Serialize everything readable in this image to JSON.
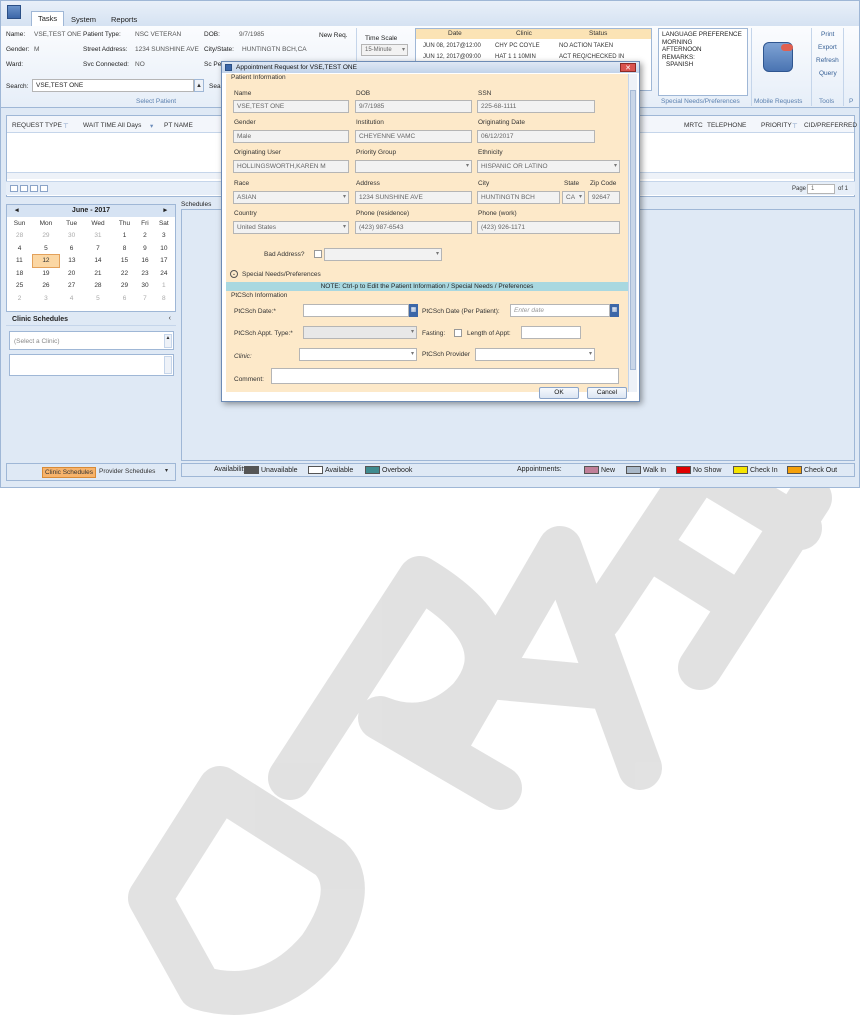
{
  "ribbon": {
    "tabs": [
      "Tasks",
      "System",
      "Reports"
    ],
    "patient": {
      "name_label": "Name:",
      "name": "VSE,TEST ONE",
      "ptype_label": "Patient Type:",
      "ptype": "NSC VETERAN",
      "dob_label": "DOB:",
      "dob": "9/7/1985",
      "gender_label": "Gender:",
      "gender": "M",
      "street_label": "Street Address:",
      "street": "1234 SUNSHINE AVE",
      "citystate_label": "City/State:",
      "citystate": "HUNTINGTN BCH,CA",
      "ward_label": "Ward:",
      "svc_label": "Svc Connected:",
      "svc": "NO",
      "sc_label": "Sc Pe",
      "search_label": "Search:",
      "search_value": "VSE,TEST ONE",
      "search_btn": "Sea",
      "group_caption": "Select Patient"
    },
    "new_req": "New Req.",
    "time_scale": {
      "label": "Time Scale",
      "value": "15-Minute"
    },
    "history": {
      "headers": [
        "Date",
        "Clinic",
        "Status"
      ],
      "rows": [
        [
          "JUN 08, 2017@12:00",
          "CHY PC COYLE",
          "NO ACTION TAKEN"
        ],
        [
          "JUN 12, 2017@09:00",
          "HAT 1 1 10MIN",
          "ACT REQ/CHECKED IN"
        ]
      ]
    },
    "special_needs": {
      "lines": [
        "LANGUAGE PREFERENCE",
        "MORNING",
        "AFTERNOON",
        "REMARKS:",
        "  SPANISH"
      ],
      "caption": "Special Needs/Preferences"
    },
    "mobile_caption": "Mobile Requests",
    "tools": {
      "items": [
        "Print",
        "Export",
        "Refresh",
        "Query"
      ],
      "caption": "Tools"
    },
    "extra_caption": "P"
  },
  "grid": {
    "headers": [
      "REQUEST TYPE",
      "WAIT TIME All Days",
      "PT NAME",
      "MRTC",
      "TELEPHONE",
      "PRIORITY",
      "CID/PREFERRED"
    ],
    "page_label": "Page",
    "page_value": "1",
    "of_label": "of 1"
  },
  "calendar": {
    "title": "June - 2017",
    "days": [
      "Sun",
      "Mon",
      "Tue",
      "Wed",
      "Thu",
      "Fri",
      "Sat"
    ],
    "weeks": [
      [
        "28",
        "29",
        "30",
        "31",
        "1",
        "2",
        "3"
      ],
      [
        "4",
        "5",
        "6",
        "7",
        "8",
        "9",
        "10"
      ],
      [
        "11",
        "12",
        "13",
        "14",
        "15",
        "16",
        "17"
      ],
      [
        "18",
        "19",
        "20",
        "21",
        "22",
        "23",
        "24"
      ],
      [
        "25",
        "26",
        "27",
        "28",
        "29",
        "30",
        "1"
      ],
      [
        "2",
        "3",
        "4",
        "5",
        "6",
        "7",
        "8"
      ]
    ],
    "today": "12"
  },
  "clinic_schedules": {
    "header": "Clinic Schedules",
    "select_placeholder": "(Select a Clinic)"
  },
  "bottom_tabs": [
    "Clinic Schedules",
    "Provider Schedules"
  ],
  "schedules_label": "Schedules",
  "legend": {
    "availability_label": "Availability:",
    "availability": [
      {
        "label": "Unavailable",
        "color": "#555555"
      },
      {
        "label": "Available",
        "color": "#ffffff"
      },
      {
        "label": "Overbook",
        "color": "#3f8b8f"
      }
    ],
    "appointments_label": "Appointments:",
    "appointments": [
      {
        "label": "New",
        "color": "#c07f98"
      },
      {
        "label": "Walk In",
        "color": "#a9b8c8"
      },
      {
        "label": "No Show",
        "color": "#e00000"
      },
      {
        "label": "Check In",
        "color": "#f5e400"
      },
      {
        "label": "Check Out",
        "color": "#f5a00a"
      }
    ]
  },
  "dialog": {
    "title": "Appointment Request for VSE,TEST ONE",
    "patient_section": "Patient Information",
    "fields": {
      "name_l": "Name",
      "name_v": "VSE,TEST ONE",
      "dob_l": "DOB",
      "dob_v": "9/7/1985",
      "ssn_l": "SSN",
      "ssn_v": "225-68-1111",
      "gender_l": "Gender",
      "gender_v": "Male",
      "inst_l": "Institution",
      "inst_v": "CHEYENNE VAMC",
      "orig_date_l": "Originating Date",
      "orig_date_v": "06/12/2017",
      "orig_user_l": "Originating User",
      "orig_user_v": "HOLLINGSWORTH,KAREN M",
      "prio_l": "Priority Group",
      "prio_v": "",
      "eth_l": "Ethnicity",
      "eth_v": "HISPANIC OR LATINO",
      "race_l": "Race",
      "race_v": "ASIAN",
      "addr_l": "Address",
      "addr_v": "1234 SUNSHINE AVE",
      "city_l": "City",
      "city_v": "HUNTINGTN BCH",
      "state_l": "State",
      "state_v": "CA",
      "zip_l": "Zip Code",
      "zip_v": "92647",
      "country_l": "Country",
      "country_v": "United States",
      "phone_res_l": "Phone (residence)",
      "phone_res_v": "(423) 987-6543",
      "phone_work_l": "Phone (work)",
      "phone_work_v": "(423) 926-1171",
      "bad_addr_l": "Bad Address?"
    },
    "special_needs_toggle": "Special Needs/Preferences",
    "note": "NOTE:  Ctrl-p to Edit the Patient Information / Special Needs / Preferences",
    "ptcsch_section": "PtCSch Information",
    "ptcsch": {
      "date_l": "PtCSch Date:*",
      "date_pt_l": "PtCSch Date (Per Patient):",
      "date_pt_placeholder": "Enter date",
      "type_l": "PtCSch Appt. Type:*",
      "fasting_l": "Fasting:",
      "length_l": "Length of Appt:",
      "clinic_l": "Clinic:",
      "provider_l": "PtCSch Provider",
      "comment_l": "Comment:"
    },
    "ok": "OK",
    "cancel": "Cancel"
  },
  "watermark": "DRAFT"
}
